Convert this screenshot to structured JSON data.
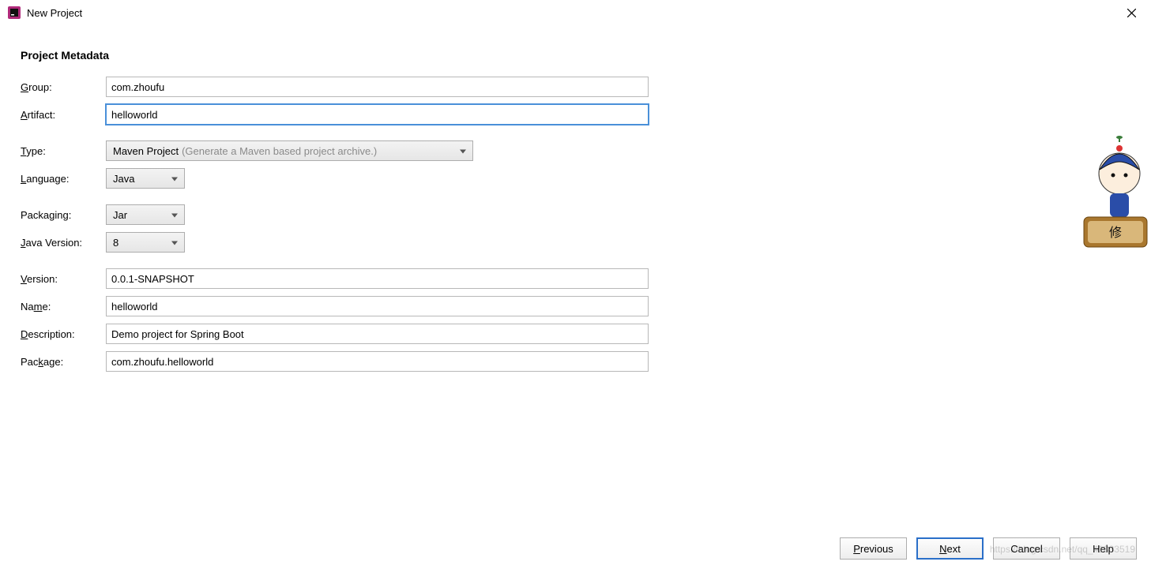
{
  "window": {
    "title": "New Project"
  },
  "section": {
    "title": "Project Metadata"
  },
  "labels": {
    "group_pre": "G",
    "group_rest": "roup:",
    "artifact_pre": "A",
    "artifact_rest": "rtifact:",
    "type_pre": "T",
    "type_rest": "ype:",
    "language_pre": "L",
    "language_rest": "anguage:",
    "packaging": "Packaging:",
    "java_pre": "J",
    "java_rest": "ava Version:",
    "version_pre": "V",
    "version_rest": "ersion:",
    "name_pre": "Na",
    "name_u": "m",
    "name_rest": "e:",
    "description_pre": "D",
    "description_rest": "escription:",
    "package_pre": "Pac",
    "package_u": "k",
    "package_rest": "age:"
  },
  "fields": {
    "group": "com.zhoufu",
    "artifact": "helloworld",
    "type": "Maven Project",
    "type_hint": "(Generate a Maven based project archive.)",
    "language": "Java",
    "packaging": "Jar",
    "java_version": "8",
    "version": "0.0.1-SNAPSHOT",
    "name": "helloworld",
    "description": "Demo project for Spring Boot",
    "package": "com.zhoufu.helloworld"
  },
  "buttons": {
    "previous_pre": "P",
    "previous_rest": "revious",
    "next_pre": "N",
    "next_rest": "ext",
    "cancel": "Cancel",
    "help": "Help"
  },
  "watermark": "https://blog.csdn.net/qq_41833519"
}
